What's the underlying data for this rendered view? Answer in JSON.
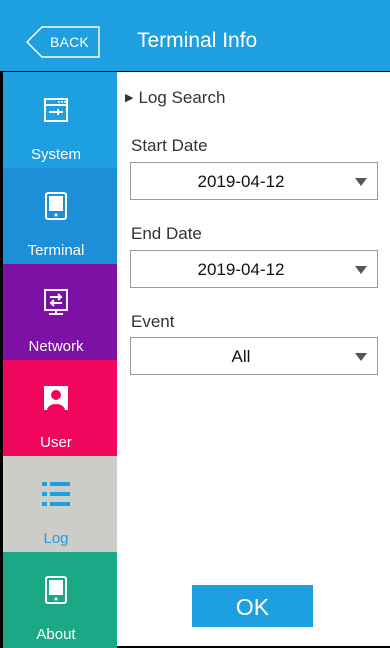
{
  "header": {
    "back_label": "BACK",
    "title": "Terminal Info"
  },
  "sidebar": {
    "items": [
      {
        "label": "System",
        "icon": "system-icon",
        "color": "#1e9fe0"
      },
      {
        "label": "Terminal",
        "icon": "terminal-icon",
        "color": "#1c8fd8"
      },
      {
        "label": "Network",
        "icon": "network-icon",
        "color": "#7d11a6"
      },
      {
        "label": "User",
        "icon": "user-icon",
        "color": "#f0065d"
      },
      {
        "label": "Log",
        "icon": "log-icon",
        "color": "#ccccc8",
        "selected": true
      },
      {
        "label": "About",
        "icon": "about-icon",
        "color": "#1aa886"
      }
    ]
  },
  "main": {
    "section_title": "Log Search",
    "start_date": {
      "label": "Start Date",
      "value": "2019-04-12"
    },
    "end_date": {
      "label": "End Date",
      "value": "2019-04-12"
    },
    "event": {
      "label": "Event",
      "value": "All"
    },
    "ok_label": "OK"
  },
  "colors": {
    "accent": "#1e9fe0"
  }
}
